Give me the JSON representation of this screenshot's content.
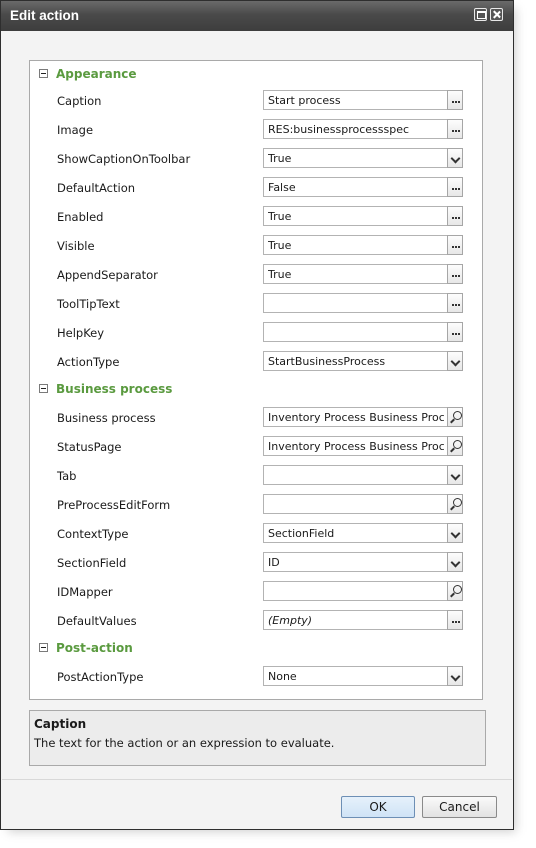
{
  "window": {
    "title": "Edit action"
  },
  "sections": [
    {
      "name": "Appearance"
    },
    {
      "name": "Business process"
    },
    {
      "name": "Post-action"
    }
  ],
  "properties": [
    {
      "label": "Caption",
      "value": "Start process",
      "editor": "ellipsis-button"
    },
    {
      "label": "Image",
      "value": "RES:businessprocessspec",
      "editor": "ellipsis-button"
    },
    {
      "label": "ShowCaptionOnToolbar",
      "value": "True",
      "editor": "dropdown"
    },
    {
      "label": "DefaultAction",
      "value": "False",
      "editor": "ellipsis-button"
    },
    {
      "label": "Enabled",
      "value": "True",
      "editor": "ellipsis-button"
    },
    {
      "label": "Visible",
      "value": "True",
      "editor": "ellipsis-button"
    },
    {
      "label": "AppendSeparator",
      "value": "True",
      "editor": "ellipsis-button"
    },
    {
      "label": "ToolTipText",
      "value": "",
      "editor": "ellipsis-button"
    },
    {
      "label": "HelpKey",
      "value": "",
      "editor": "ellipsis-button"
    },
    {
      "label": "ActionType",
      "value": "StartBusinessProcess",
      "editor": "dropdown"
    },
    {
      "label": "Business process",
      "value": "Inventory Process Business Process",
      "editor": "lookup"
    },
    {
      "label": "StatusPage",
      "value": "Inventory Process Business Process",
      "editor": "lookup"
    },
    {
      "label": "Tab",
      "value": "",
      "editor": "dropdown"
    },
    {
      "label": "PreProcessEditForm",
      "value": "",
      "editor": "lookup"
    },
    {
      "label": "ContextType",
      "value": "SectionField",
      "editor": "dropdown"
    },
    {
      "label": "SectionField",
      "value": "ID",
      "editor": "dropdown"
    },
    {
      "label": "IDMapper",
      "value": "",
      "editor": "lookup"
    },
    {
      "label": "DefaultValues",
      "value": "(Empty)",
      "editor": "ellipsis-button"
    },
    {
      "label": "PostActionType",
      "value": "None",
      "editor": "dropdown"
    }
  ],
  "description": {
    "title": "Caption",
    "text": "The text for the action or an expression to evaluate."
  },
  "buttons": {
    "ok": "OK",
    "cancel": "Cancel"
  },
  "colors": {
    "section_header": "#5a9a3f",
    "titlebar": "#4a4a4a",
    "ok_button": "#cfe3f6"
  }
}
